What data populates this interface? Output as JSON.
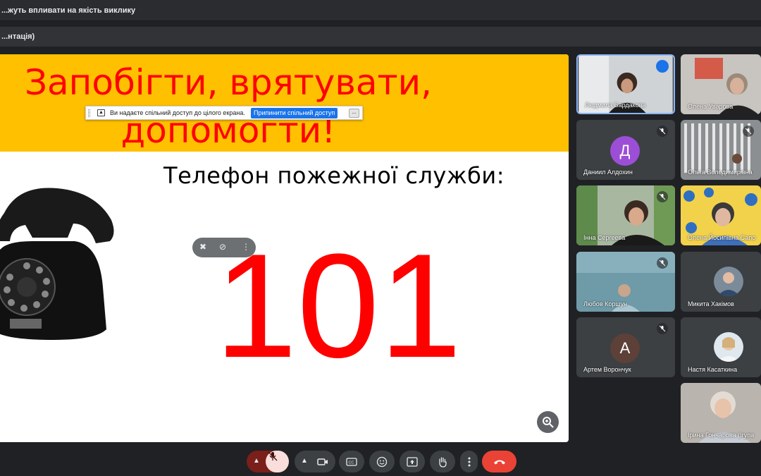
{
  "window": {
    "title": "...жуть впливати на якість виклику",
    "subtitle": "...нтація)"
  },
  "slide": {
    "title": "Запобігти, врятувати, допомогти!",
    "subtitle": "Телефон пожежної служби:",
    "number": "101",
    "colors": {
      "banner": "#ffc000",
      "text": "#ff0000"
    }
  },
  "share_banner": {
    "message": "Ви надаєте спільний доступ до цілого екрана.",
    "stop_label": "Припинити спільний доступ",
    "hide_label": "..."
  },
  "participants": [
    {
      "name": "Людмила Бардакова",
      "speaking": true
    },
    {
      "name": "Олена Уварова"
    },
    {
      "name": "Даниил Алдохин",
      "initial": "Д",
      "color": "#9c4fd6",
      "muted": true
    },
    {
      "name": "Ольга Володимирівна",
      "muted": true
    },
    {
      "name": "Інна Сергеева",
      "muted": true
    },
    {
      "name": "Олена Йосипівна Сапо",
      "muted": true
    },
    {
      "name": "Любов Коршун",
      "muted": true
    },
    {
      "name": "Микита Хакімов"
    },
    {
      "name": "Артем Ворончук",
      "initial": "А",
      "color": "#5d4037",
      "muted": true
    },
    {
      "name": "Настя Касаткина"
    },
    {
      "name": "Ірина Гончарова (Ігупа"
    }
  ],
  "controls": {
    "hangup_color": "#ea4335",
    "mic_muted": true
  }
}
